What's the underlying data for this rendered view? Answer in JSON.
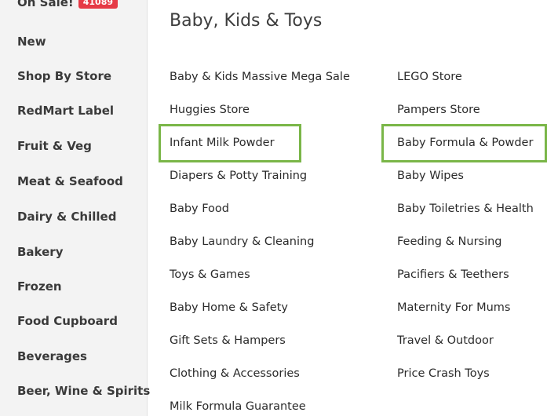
{
  "sidebar": {
    "sale_label": "On Sale!",
    "sale_badge": "41089",
    "items": [
      "New",
      "Shop By Store",
      "RedMart Label",
      "Fruit & Veg",
      "Meat & Seafood",
      "Dairy & Chilled",
      "Bakery",
      "Frozen",
      "Food Cupboard",
      "Beverages",
      "Beer, Wine & Spirits"
    ]
  },
  "main": {
    "title": "Baby, Kids & Toys",
    "column1": [
      "Baby & Kids Massive Mega Sale",
      "Huggies Store",
      "Infant Milk Powder",
      "Diapers & Potty Training",
      "Baby Food",
      "Baby Laundry & Cleaning",
      "Toys & Games",
      "Baby Home & Safety",
      "Gift Sets & Hampers",
      "Clothing & Accessories",
      "Milk Formula Guarantee"
    ],
    "column2": [
      "LEGO Store",
      "Pampers Store",
      "Baby Formula & Powder",
      "Baby Wipes",
      "Baby Toiletries & Health",
      "Feeding & Nursing",
      "Pacifiers & Teethers",
      "Maternity For Mums",
      "Travel & Outdoor",
      "Price Crash Toys"
    ]
  },
  "colors": {
    "sidebar_bg": "#f3f3f3",
    "badge": "#e63a46",
    "highlight": "#7ab648"
  }
}
